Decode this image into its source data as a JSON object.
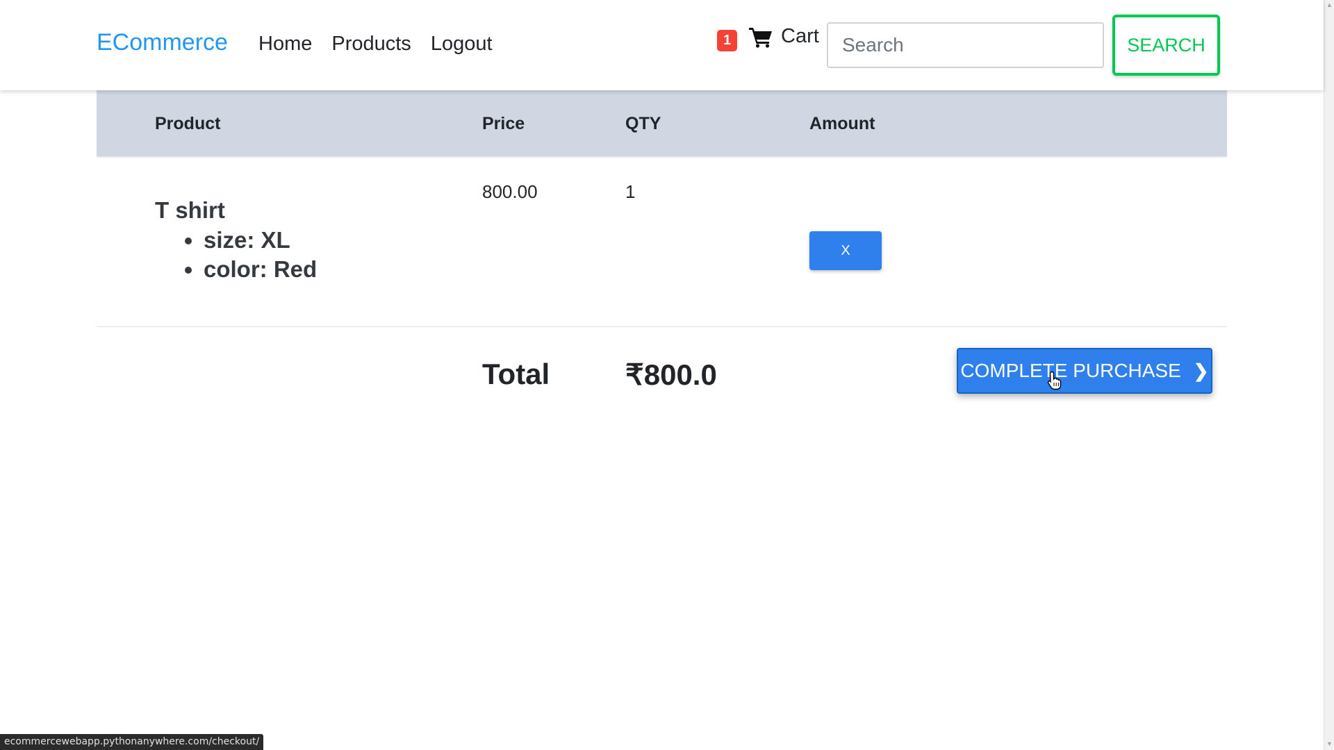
{
  "nav": {
    "brand": "ECommerce",
    "links": [
      "Home",
      "Products",
      "Logout"
    ],
    "cart_count": "1",
    "cart_label": "Cart",
    "search_placeholder": "Search",
    "search_button": "SEARCH"
  },
  "table": {
    "headers": [
      "Product",
      "Price",
      "QTY",
      "Amount"
    ],
    "rows": [
      {
        "product": "T shirt",
        "attributes": [
          "size: XL",
          "color: Red"
        ],
        "price": "800.00",
        "qty": "1",
        "remove_label": "X"
      }
    ]
  },
  "summary": {
    "total_label": "Total",
    "total_value": "₹800.0",
    "purchase_button": "COMPLETE PURCHASE",
    "purchase_icon": "chevron-right-icon"
  },
  "status_bar": {
    "url": "ecommercewebapp.pythonanywhere.com/checkout/"
  },
  "colors": {
    "brand": "#2196f3",
    "badge": "#f44336",
    "search_accent": "#00c853",
    "primary_button": "#2f80ed",
    "table_header_bg": "#d1d7e2"
  }
}
